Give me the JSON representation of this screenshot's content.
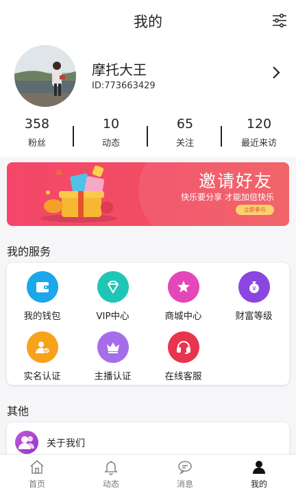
{
  "header": {
    "title": "我的",
    "settings_icon": "settings-sliders-icon"
  },
  "profile": {
    "username": "摩托大王",
    "user_id": "ID:773663429",
    "stats": [
      {
        "value": "358",
        "label": "粉丝"
      },
      {
        "value": "10",
        "label": "动态"
      },
      {
        "value": "65",
        "label": "关注"
      },
      {
        "value": "120",
        "label": "最近来访"
      }
    ]
  },
  "banner": {
    "title": "邀请好友",
    "subtitle": "快乐要分享 才能加倍快乐",
    "button": "立即参与"
  },
  "services": {
    "title": "我的服务",
    "items": [
      {
        "label": "我的钱包",
        "icon": "wallet-icon",
        "color": "#1aa7ec"
      },
      {
        "label": "VIP中心",
        "icon": "diamond-icon",
        "color": "#1fc6b6"
      },
      {
        "label": "商城中心",
        "icon": "star-icon",
        "color": "#e447b8"
      },
      {
        "label": "财富等级",
        "icon": "money-bag-icon",
        "color": "#8b46e0"
      },
      {
        "label": "实名认证",
        "icon": "verified-user-icon",
        "color": "#f7a21b"
      },
      {
        "label": "主播认证",
        "icon": "crown-icon",
        "color": "#a66de9"
      },
      {
        "label": "在线客服",
        "icon": "headset-icon",
        "color": "#e8344e"
      }
    ]
  },
  "other": {
    "title": "其他",
    "items": [
      {
        "label": "关于我们",
        "icon": "group-icon"
      }
    ]
  },
  "tabbar": {
    "items": [
      {
        "label": "首页",
        "icon": "home-icon"
      },
      {
        "label": "动态",
        "icon": "bell-icon"
      },
      {
        "label": "消息",
        "icon": "chat-icon"
      },
      {
        "label": "我的",
        "icon": "person-icon",
        "active": true
      }
    ]
  }
}
